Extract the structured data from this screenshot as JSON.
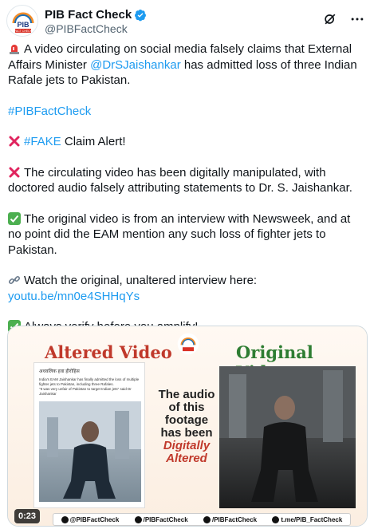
{
  "account": {
    "name": "PIB Fact Check",
    "handle": "@PIBFactCheck",
    "avatar_text": "PIB",
    "avatar_subtext": "FACT CHECK"
  },
  "tweet": {
    "p1_text": "A video circulating on social media falsely claims that External Affairs Minister ",
    "p1_mention": "@DrSJaishankar",
    "p1_tail": " has admitted loss of three Indian Rafale jets to Pakistan.",
    "hashtag": "#PIBFactCheck",
    "p3_hashtag": "#FAKE",
    "p3_tail": " Claim Alert!",
    "p4": "The circulating video has been digitally manipulated, with doctored audio falsely attributing statements to Dr. S. Jaishankar.",
    "p5": "The original video is from an interview with Newsweek, and at no point did the EAM mention any such loss of fighter jets to Pakistan.",
    "p6": "Watch the original, unaltered interview here:",
    "p6_link": "youtu.be/mn0e4SHHqYs",
    "p7": "Always verify before you amplify!"
  },
  "media": {
    "altered_title": "Altered Video",
    "original_title": "Original Video",
    "mini_head": "अधवलिक हवा हीरोहिस",
    "mini_body_1": "India's EAM Jaishankar has finally admitted the loss of multiple fighter jets to Pakistan, including three Rafales.",
    "mini_body_2": "\"It was very unfair of Pakistan to target Indian jets\" said Dr Jaishankar",
    "center_l1": "The audio",
    "center_l2": "of this",
    "center_l3": "footage",
    "center_l4": "has been",
    "center_red1": "Digitally",
    "center_red2": "Altered",
    "footer": [
      "@PIBFactCheck",
      "/PIBFactCheck",
      "/PIBFactCheck",
      "t.me/PIB_FactCheck"
    ],
    "duration": "0:23"
  },
  "colors": {
    "link": "#1d9bf0",
    "verified": "#1d9bf0",
    "red_x": "#e0245e",
    "check_green": "#4caf50"
  },
  "icons": [
    "verified-badge-icon",
    "grok-icon",
    "more-icon",
    "siren-icon",
    "red-x-icon",
    "check-mark-icon",
    "link-icon"
  ]
}
